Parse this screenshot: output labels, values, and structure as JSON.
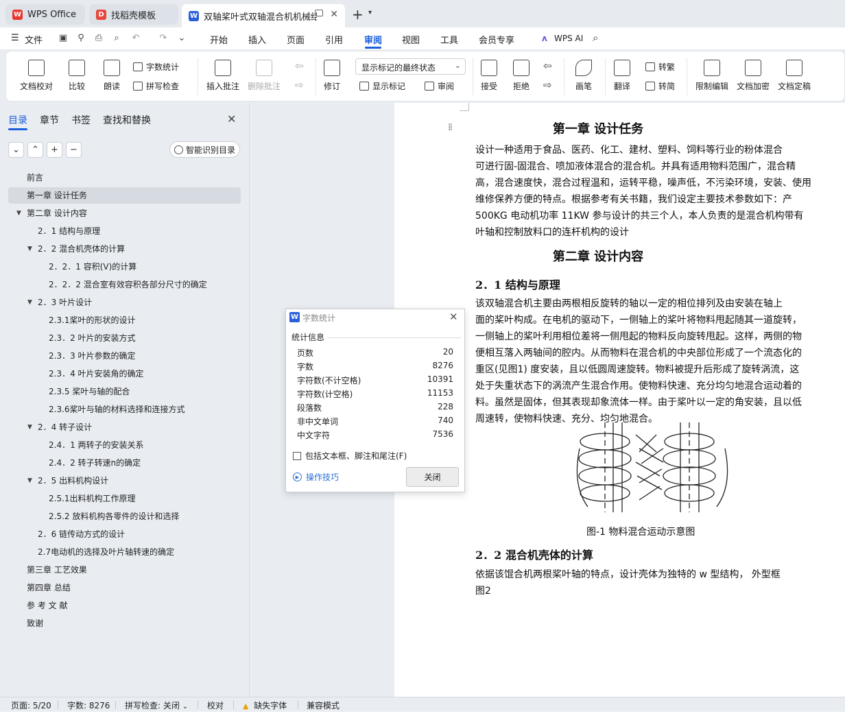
{
  "tabs": [
    {
      "label": "WPS Office",
      "active": false
    },
    {
      "label": "找稻壳模板",
      "active": false
    },
    {
      "label": "双轴桨叶式双轴混合机机械结",
      "active": true
    }
  ],
  "new_tab": "+",
  "menu": {
    "file": "文件",
    "items": [
      "开始",
      "插入",
      "页面",
      "引用",
      "审阅",
      "视图",
      "工具",
      "会员专享"
    ],
    "active": "审阅",
    "wps_ai": "WPS AI"
  },
  "ribbon": {
    "proofread": "文档校对",
    "compare": "比较",
    "read_aloud": "朗读",
    "word_count": "字数统计",
    "spell_check": "拼写检查",
    "insert_comment": "插入批注",
    "delete_comment": "删除批注",
    "revise": "修订",
    "markup_select": "显示标记的最终状态",
    "show_markup": "显示标记",
    "review_pane": "审阅",
    "accept": "接受",
    "reject": "拒绝",
    "pen": "画笔",
    "translate": "翻译",
    "to_traditional": "转繁",
    "to_simplified": "转简",
    "restrict_edit": "限制编辑",
    "encrypt": "文档加密",
    "finalize": "文档定稿"
  },
  "nav": {
    "tabs": [
      "目录",
      "章节",
      "书签",
      "查找和替换"
    ],
    "active_tab": "目录",
    "smart_toc": "智能识别目录",
    "toc": [
      {
        "label": "前言",
        "level": 1,
        "expand": ""
      },
      {
        "label": "第一章   设计任务",
        "level": 1,
        "expand": "",
        "selected": true
      },
      {
        "label": "第二章   设计内容",
        "level": 1,
        "expand": "▼"
      },
      {
        "label": "2．1 结构与原理",
        "level": 2,
        "expand": ""
      },
      {
        "label": "2．2 混合机壳体的计算",
        "level": 2,
        "expand": "▼"
      },
      {
        "label": "2．2．1 容积(V)的计算",
        "level": 3,
        "expand": ""
      },
      {
        "label": "2．2．2 混合室有效容积各部分尺寸的确定",
        "level": 3,
        "expand": ""
      },
      {
        "label": "2．3 叶片设计",
        "level": 2,
        "expand": "▼"
      },
      {
        "label": "2.3.1桨叶的形状的设计",
        "level": 3,
        "expand": ""
      },
      {
        "label": "2.3．2 叶片的安装方式",
        "level": 3,
        "expand": ""
      },
      {
        "label": "2.3．3 叶片参数的确定",
        "level": 3,
        "expand": ""
      },
      {
        "label": "2.3．4 叶片安装角的确定",
        "level": 3,
        "expand": ""
      },
      {
        "label": "2.3.5  桨叶与轴的配合",
        "level": 3,
        "expand": ""
      },
      {
        "label": "2.3.6桨叶与轴的材料选择和连接方式",
        "level": 3,
        "expand": ""
      },
      {
        "label": "2．4 转子设计",
        "level": 2,
        "expand": "▼"
      },
      {
        "label": "2.4．1 两转子的安装关系",
        "level": 3,
        "expand": ""
      },
      {
        "label": "2.4．2 转子转速n的确定",
        "level": 3,
        "expand": ""
      },
      {
        "label": "2．5 出料机构设计",
        "level": 2,
        "expand": "▼"
      },
      {
        "label": "2.5.1出料机构工作原理",
        "level": 3,
        "expand": ""
      },
      {
        "label": "2.5.2  放料机构各零件的设计和选择",
        "level": 3,
        "expand": ""
      },
      {
        "label": "2．6 链传动方式的设计",
        "level": 2,
        "expand": ""
      },
      {
        "label": "2.7电动机的选择及叶片轴转速的确定",
        "level": 2,
        "expand": ""
      },
      {
        "label": "第三章   工艺效果",
        "level": 1,
        "expand": ""
      },
      {
        "label": "第四章 总结",
        "level": 1,
        "expand": ""
      },
      {
        "label": "参 考 文 献",
        "level": 1,
        "expand": ""
      },
      {
        "label": "致谢",
        "level": 1,
        "expand": ""
      }
    ]
  },
  "document": {
    "h1_chapter1": "第一章    设计任务",
    "p1": [
      "    设计一种适用于食品、医药、化工、建材、塑料、饲料等行业的粉体混合",
      "可进行固-固混合、喷加液体混合的混合机。并具有适用物料范围广，混合精",
      "高，混合速度快，混合过程温和，运转平稳，噪声低，不污染环境，安装、使用",
      "维修保养方便的特点。根据参考有关书籍，我们设定主要技术参数如下：产",
      "500KG 电动机功率 11KW   参与设计的共三个人，本人负责的是混合机构带有",
      "叶轴和控制放料口的连杆机构的设计"
    ],
    "h1_chapter2": "第二章    设计内容",
    "h2_1": "2．1 结构与原理",
    "p2": [
      "    该双轴混合机主要由两根相反旋转的轴以一定的相位排列及由安装在轴上",
      "面的桨叶构成。在电机的驱动下，一侧轴上的桨叶将物料甩起随其一道旋转，",
      "一侧轴上的桨叶利用相位差将一侧甩起的物料反向旋转甩起。这样，两侧的物",
      "便相互落入两轴间的腔内。从而物料在混合机的中央部位形成了一个流态化的",
      "重区(见图1) 度安装，且以低圆周速旋转。物料被提升后形成了旋转涡流，这",
      "处于失重状态下的涡流产生混合作用。使物料快速、充分均匀地混合运动着的",
      "料。虽然是固体，但其表现却象流体一样。由于桨叶以一定的角安装，且以低",
      "周速转，使物料快速、充分、均匀地混合。"
    ],
    "figure_caption": "图-1 物料混合运动示意图",
    "h2_2": "2．2 混合机壳体的计算",
    "p3": [
      "    依据该馄合机两根桨叶轴的特点，设计壳体为独特的 w 型结构，  外型框",
      "图2"
    ]
  },
  "dialog": {
    "title": "字数统计",
    "section": "统计信息",
    "stats": [
      {
        "label": "页数",
        "value": "20"
      },
      {
        "label": "字数",
        "value": "8276"
      },
      {
        "label": "字符数(不计空格)",
        "value": "10391"
      },
      {
        "label": "字符数(计空格)",
        "value": "11153"
      },
      {
        "label": "段落数",
        "value": "228"
      },
      {
        "label": "非中文单词",
        "value": "740"
      },
      {
        "label": "中文字符",
        "value": "7536"
      }
    ],
    "include_label": "包括文本框、脚注和尾注(F)",
    "tips": "操作技巧",
    "close": "关闭"
  },
  "status": {
    "page": "页面: 5/20",
    "words": "字数: 8276",
    "spell": "拼写检查: 关闭",
    "proof": "校对",
    "missing_font": "缺失字体",
    "compat": "兼容模式"
  },
  "colors": {
    "accent": "#1a5edb",
    "wps_red": "#e8352e",
    "docer_red": "#e8453c",
    "writer_blue": "#2b5fd9"
  }
}
